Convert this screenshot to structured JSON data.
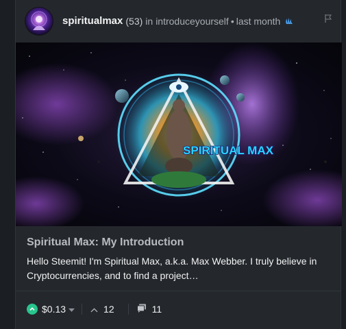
{
  "post": {
    "author": "spiritualmax",
    "reputation": "(53)",
    "in_text": "in",
    "community": "introduceyourself",
    "separator": "•",
    "time": "last month",
    "image_text": "SPIRITUAL MAX",
    "title": "Spiritual Max: My Introduction",
    "excerpt": "Hello Steemit! I'm Spiritual Max, a.k.a. Max Webber. I truly believe in Cryptocurrencies, and to find a project…"
  },
  "footer": {
    "payout": "$0.13",
    "votes": "12",
    "comments": "11"
  },
  "colors": {
    "accent": "#28c58d",
    "image_text": "#2ad4ff"
  }
}
